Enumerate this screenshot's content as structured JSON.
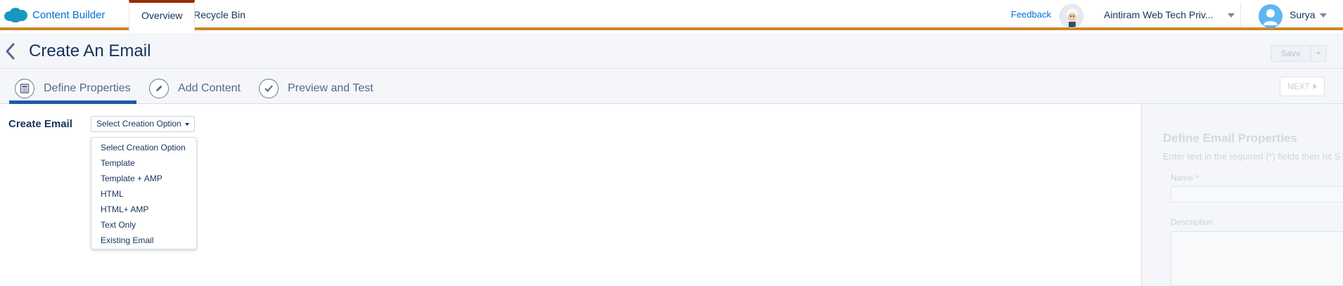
{
  "app": {
    "brand_name": "Content Builder",
    "tabs": [
      {
        "label": "Overview",
        "active": true
      },
      {
        "label": "Recycle Bin",
        "active": false
      }
    ],
    "feedback_label": "Feedback",
    "org_name": "Aintiram Web Tech Priv...",
    "user_name": "Surya",
    "accent_color": "#cd8729",
    "active_tab_color": "#9a2a04"
  },
  "page": {
    "title": "Create An Email",
    "save_label": "Save"
  },
  "wizard": {
    "steps": [
      {
        "label": "Define Properties",
        "icon": "calculator-icon",
        "active": true
      },
      {
        "label": "Add Content",
        "icon": "pencil-icon",
        "active": false
      },
      {
        "label": "Preview and Test",
        "icon": "check-icon",
        "active": false
      }
    ],
    "next_label": "NEXT"
  },
  "main": {
    "create_label": "Create Email",
    "select_value": "Select Creation Option",
    "dropdown_options": [
      "Select Creation Option",
      "Template",
      "Template + AMP",
      "HTML",
      "HTML+ AMP",
      "Text Only",
      "Existing Email"
    ]
  },
  "properties_panel": {
    "title": "Define Email Properties",
    "subtitle": "Enter text in the required (*) fields then hit S",
    "name_label": "Name *",
    "description_label": "Description"
  }
}
